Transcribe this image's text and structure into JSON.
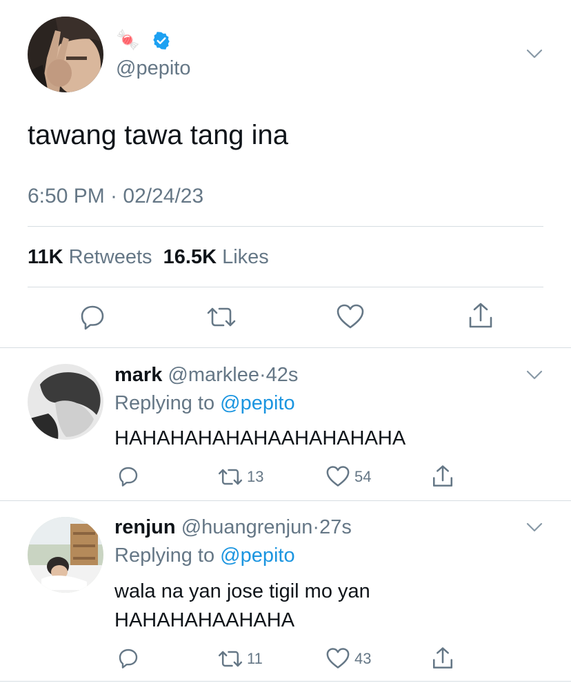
{
  "main_tweet": {
    "display_name_emoji": "🍬",
    "verified_icon": "verified-badge-icon",
    "handle": "@pepito",
    "text": "tawang tawa tang ina",
    "timestamp": "6:50 PM · 02/24/23",
    "stats": {
      "retweets_count": "11K",
      "retweets_label": "Retweets",
      "likes_count": "16.5K",
      "likes_label": "Likes"
    },
    "actions": [
      "reply-icon",
      "retweet-icon",
      "like-icon",
      "share-icon"
    ]
  },
  "replies": [
    {
      "name": "mark",
      "handle": "@marklee",
      "separator": "·",
      "time": "42s",
      "replying_label": "Replying to",
      "replying_handle": "@pepito",
      "text_lines": [
        "HAHAHAHAHAHAAHAHAHAHA"
      ],
      "retweets": "13",
      "likes": "54"
    },
    {
      "name": "renjun",
      "handle": "@huangrenjun",
      "separator": "·",
      "time": "27s",
      "replying_label": "Replying to",
      "replying_handle": "@pepito",
      "text_lines": [
        "wala na yan jose tigil mo yan",
        "HAHAHAHAAHAHA"
      ],
      "retweets": "11",
      "likes": "43"
    }
  ],
  "colors": {
    "text": "#0f1419",
    "secondary": "#657786",
    "link": "#1b95e0",
    "verified": "#1da1f2",
    "divider": "#d6dde2"
  }
}
